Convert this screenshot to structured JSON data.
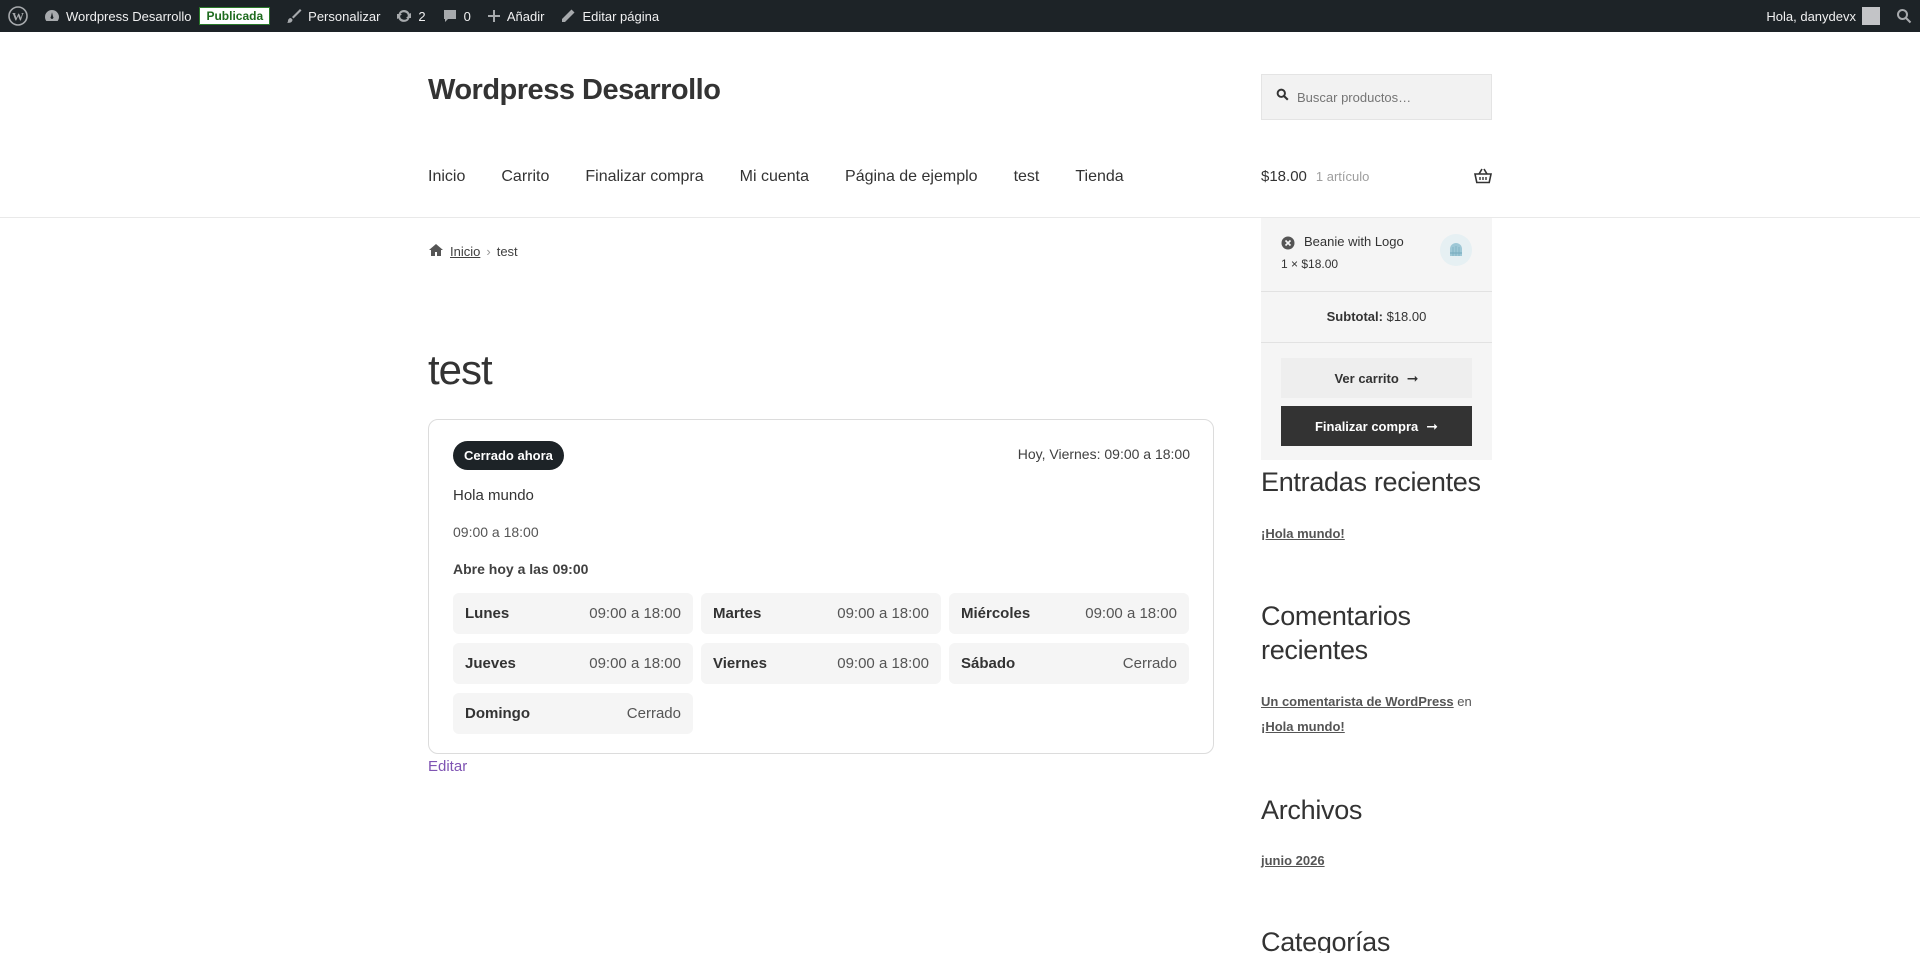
{
  "adminbar": {
    "site_name": "Wordpress Desarrollo",
    "status_badge": "Publicada",
    "customize": "Personalizar",
    "updates_count": "2",
    "comments_count": "0",
    "add_new": "Añadir",
    "edit_page": "Editar página",
    "greeting": "Hola, danydevx"
  },
  "header": {
    "site_title": "Wordpress Desarrollo",
    "search_placeholder": "Buscar productos…",
    "nav": [
      "Inicio",
      "Carrito",
      "Finalizar compra",
      "Mi cuenta",
      "Página de ejemplo",
      "test",
      "Tienda"
    ],
    "cart_total": "$18.00",
    "cart_count": "1 artículo"
  },
  "breadcrumb": {
    "home": "Inicio",
    "separator": "›",
    "current": "test"
  },
  "page": {
    "title": "test",
    "edit_link": "Editar"
  },
  "hours_card": {
    "status": "Cerrado ahora",
    "today": "Hoy, Viernes: 09:00 a 18:00",
    "location_name": "Hola mundo",
    "location_hours": "09:00 a 18:00",
    "opens_today": "Abre hoy a las 09:00",
    "days": [
      {
        "name": "Lunes",
        "hours": "09:00 a 18:00"
      },
      {
        "name": "Martes",
        "hours": "09:00 a 18:00"
      },
      {
        "name": "Miércoles",
        "hours": "09:00 a 18:00"
      },
      {
        "name": "Jueves",
        "hours": "09:00 a 18:00"
      },
      {
        "name": "Viernes",
        "hours": "09:00 a 18:00"
      },
      {
        "name": "Sábado",
        "hours": "Cerrado"
      },
      {
        "name": "Domingo",
        "hours": "Cerrado"
      }
    ]
  },
  "minicart": {
    "item_name": "Beanie with Logo",
    "item_qty": "1 × $18.00",
    "subtotal_label": "Subtotal:",
    "subtotal_value": "$18.00",
    "view_cart": "Ver carrito",
    "checkout": "Finalizar compra"
  },
  "sidebar": {
    "recent_posts_title": "Entradas recientes",
    "recent_post": "¡Hola mundo!",
    "recent_comments_title": "Comentarios recientes",
    "comment_author": "Un comentarista de WordPress",
    "comment_on": "en",
    "comment_post": "¡Hola mundo!",
    "archives_title": "Archivos",
    "archive_item": "junio 2026",
    "categories_title": "Categorías"
  },
  "colors": {
    "adminbar_bg": "#1d2327",
    "accent_link": "#7f54b3",
    "dark_button": "#333333"
  }
}
